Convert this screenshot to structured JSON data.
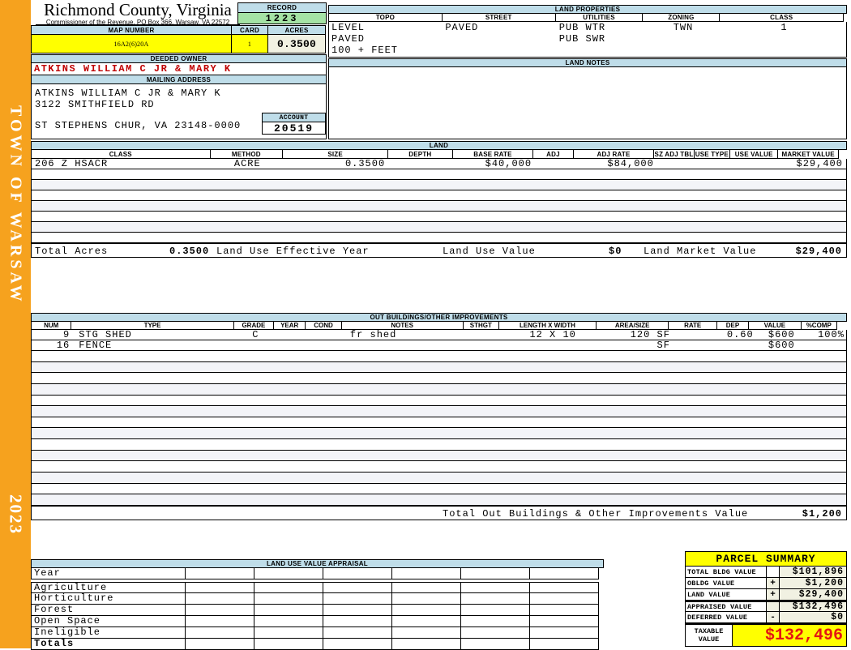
{
  "sidebar": {
    "title": "TOWN OF WARSAW",
    "year": "2023"
  },
  "header": {
    "county": "Richmond County, Virginia",
    "subtitle": "Commissioner of the Revenue, PO Box 366, Warsaw, VA 22572",
    "record_label": "RECORD",
    "record": "1223",
    "map_number_label": "MAP NUMBER",
    "map_number": "16A2(6)20A",
    "card_label": "CARD",
    "card": "1",
    "acres_label": "ACRES",
    "acres": "0.3500"
  },
  "owner": {
    "deeded_owner_label": "DEEDED OWNER",
    "deeded_owner": "ATKINS WILLIAM C JR & MARY K",
    "mailing_address_label": "MAILING ADDRESS",
    "address_lines": [
      "ATKINS WILLIAM C JR & MARY K",
      "3122 SMITHFIELD RD",
      "ST STEPHENS CHUR, VA 23148-0000"
    ],
    "account_label": "ACCOUNT",
    "account": "20519"
  },
  "land_properties": {
    "title": "LAND PROPERTIES",
    "columns": [
      "TOPO",
      "STREET",
      "UTILITIES",
      "ZONING",
      "CLASS"
    ],
    "topo": [
      "LEVEL",
      "PAVED",
      "100 + FEET"
    ],
    "street": [
      "PAVED"
    ],
    "utilities": [
      "PUB WTR",
      "PUB SWR"
    ],
    "zoning": [
      "TWN"
    ],
    "class": [
      "1"
    ]
  },
  "land_notes": {
    "title": "LAND NOTES",
    "text": ""
  },
  "land": {
    "title": "LAND",
    "columns": [
      "CLASS",
      "METHOD",
      "SIZE",
      "DEPTH",
      "BASE RATE",
      "ADJ",
      "ADJ RATE",
      "SZ ADJ TBL",
      "USE TYPE",
      "USE VALUE",
      "MARKET VALUE"
    ],
    "rows": [
      {
        "class": "206 Z HSACR",
        "method": "ACRE",
        "size": "0.3500",
        "depth": "",
        "base_rate": "$40,000",
        "adj": "",
        "adj_rate": "$84,000",
        "sz_adj_tbl": "",
        "use_type": "",
        "use_value": "",
        "market_value": "$29,400"
      }
    ],
    "totals": {
      "total_acres_label": "Total Acres",
      "total_acres": "0.3500",
      "effective_year_label": "Land Use Effective Year",
      "effective_year": "",
      "use_value_label": "Land Use Value",
      "use_value": "$0",
      "market_value_label": "Land Market Value",
      "market_value": "$29,400"
    }
  },
  "out_buildings": {
    "title": "OUT BUILDINGS/OTHER IMPROVEMENTS",
    "columns": [
      "NUM",
      "TYPE",
      "GRADE",
      "YEAR",
      "COND",
      "NOTES",
      "STHGT",
      "LENGTH X WIDTH",
      "AREA/SIZE",
      "RATE",
      "DEP",
      "VALUE",
      "%COMP"
    ],
    "rows": [
      {
        "num": "9",
        "type": "STG SHED",
        "grade": "C",
        "year": "",
        "cond": "",
        "notes": "fr shed",
        "sthgt": "",
        "length_x_width": "12 X 10",
        "area_size": "120 SF",
        "rate": "",
        "dep": "0.60",
        "value": "$600",
        "pct_comp": "100%"
      },
      {
        "num": "16",
        "type": "FENCE",
        "grade": "",
        "year": "",
        "cond": "",
        "notes": "",
        "sthgt": "",
        "length_x_width": "",
        "area_size": "SF",
        "rate": "",
        "dep": "",
        "value": "$600",
        "pct_comp": ""
      }
    ],
    "total_label": "Total Out Buildings & Other Improvements Value",
    "total_value": "$1,200"
  },
  "land_use_appraisal": {
    "title": "LAND USE VALUE APPRAISAL",
    "row_labels": [
      "Year",
      "Agriculture",
      "Horticulture",
      "Forest",
      "Open Space",
      "Ineligible",
      "Totals"
    ]
  },
  "parcel_summary": {
    "title": "PARCEL SUMMARY",
    "rows": [
      {
        "label": "TOTAL BLDG VALUE",
        "op": "",
        "value": "$101,896"
      },
      {
        "label": "OBLDG VALUE",
        "op": "+",
        "value": "$1,200"
      },
      {
        "label": "LAND VALUE",
        "op": "+",
        "value": "$29,400"
      },
      {
        "label": "APPRAISED VALUE",
        "op": "",
        "value": "$132,496"
      },
      {
        "label": "DEFERRED VALUE",
        "op": "-",
        "value": "$0"
      }
    ],
    "taxable_label_line1": "TAXABLE",
    "taxable_label_line2": "VALUE",
    "taxable_value": "$132,496"
  },
  "colors": {
    "band_orange": "#F6A21E",
    "header_blue": "#BFDDE9",
    "record_green": "#A5E3A5",
    "highlight_yellow": "#FFFF00",
    "value_cream": "#F1F1E2",
    "owner_red": "#C00000",
    "taxable_red": "#E41414",
    "stripe": "#F3F4F8"
  }
}
